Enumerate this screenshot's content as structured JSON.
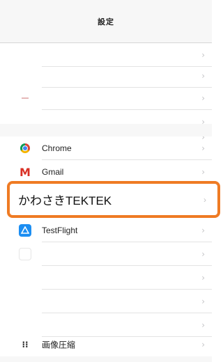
{
  "navbar": {
    "title": "設定"
  },
  "chevron": "›",
  "rows": {
    "chrome": {
      "label": "Chrome",
      "icon": "chrome-icon"
    },
    "gmail": {
      "label": "Gmail",
      "icon": "gmail-icon",
      "glyph": "M"
    },
    "testflight": {
      "label": "TestFlight",
      "icon": "testflight-icon"
    },
    "image_compress": {
      "label": "画像圧縮",
      "icon": "image-compress-icon",
      "glyph": "⁝⁝"
    }
  },
  "highlight": {
    "label": "かわさきTEKTEK"
  },
  "colors": {
    "highlight_border": "#ef7b24",
    "gmail_red": "#d93025",
    "testflight_blue": "#1c8ef2"
  }
}
